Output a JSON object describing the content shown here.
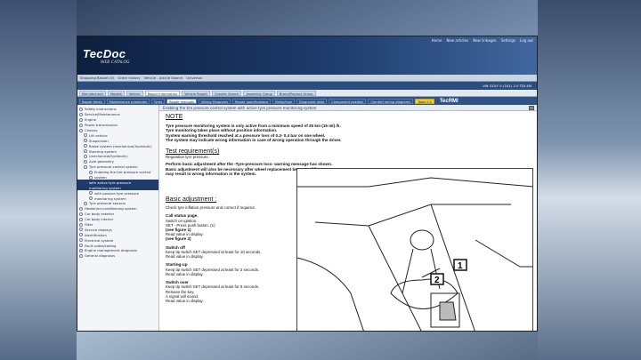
{
  "app": {
    "logo": "TecDoc",
    "logo_sub": "WEB CATALOG",
    "top_links": [
      "Home",
      "New articles",
      "New linkages",
      "Settings",
      "Log out"
    ]
  },
  "menubar": [
    "Shopping Basket (0)",
    "Order history",
    "Vehicle - Article Search",
    "Universal"
  ],
  "vehicle": "VW GOLF V (1K1) 2.0 TDI 4M",
  "tabs1": [
    "Manufacturer",
    "Models",
    "Vehicle",
    "Repair Information",
    "Vehicle Report",
    "Graphic Search",
    "Assembly Group",
    "Brand/Product Group"
  ],
  "tabs1_active": 3,
  "tabs2": [
    "Repair times",
    "Maintenance schedules",
    "Tyres",
    "Repair manuals",
    "Wiring Diagrams",
    "Repair specifications",
    "Relay/fuse",
    "Diagnostic data",
    "Component position",
    "Comfort wiring diagrams",
    "Tools 2.0"
  ],
  "tabs2_active": 3,
  "tecrmi": "TecRMI",
  "breadcrumb": "Enabling the tire pressure control system with active tyre pressure monitoring system",
  "tree": [
    {
      "label": "Safety instructions",
      "level": 0
    },
    {
      "label": "Service/Maintenance",
      "level": 0
    },
    {
      "label": "Engine",
      "level": 0
    },
    {
      "label": "Power transmission",
      "level": 0
    },
    {
      "label": "Chassis",
      "level": 0
    },
    {
      "label": "Lift vehicle",
      "level": 1
    },
    {
      "label": "Suspension",
      "level": 1
    },
    {
      "label": "Brake system (mechanical/hydraulic)",
      "level": 1
    },
    {
      "label": "Steering system",
      "level": 1
    },
    {
      "label": "(mechanical/hydraulic)",
      "level": 1
    },
    {
      "label": "Axle geometry",
      "level": 1
    },
    {
      "label": "Tyre pressure control system",
      "level": 1
    },
    {
      "label": "Enabling the tire pressure control",
      "level": 2
    },
    {
      "label": "system",
      "level": 2
    },
    {
      "label": "with active tyre pressure",
      "level": 2,
      "selected": true
    },
    {
      "label": "monitoring system",
      "level": 2,
      "selected": true
    },
    {
      "label": "with passive tyre pressure",
      "level": 2
    },
    {
      "label": "monitoring system",
      "level": 2
    },
    {
      "label": "Tyre pressure sensors",
      "level": 1
    },
    {
      "label": "Heater/air-conditioning system",
      "level": 0
    },
    {
      "label": "Car body exterior",
      "level": 0
    },
    {
      "label": "Car body interior",
      "level": 0
    },
    {
      "label": "Filter",
      "level": 0
    },
    {
      "label": "Service displays",
      "level": 0
    },
    {
      "label": "Identification",
      "level": 0
    },
    {
      "label": "Electrical system",
      "level": 0
    },
    {
      "label": "Fault codes/coding",
      "level": 0
    },
    {
      "label": "Engine management diagnosis",
      "level": 0
    },
    {
      "label": "General diagnosis",
      "level": 0
    }
  ],
  "note": {
    "heading": "NOTE",
    "lines": [
      "Tyre pressure monitoring system is only active from a minimum speed of 25 km (15 ml) /h.",
      "Tyre monitoring takes place without position information.",
      "System warning threshold reached at a pressure loss of 0.3- 0,4 bar on one wheel.",
      "The system may indicate wrong information in case of wrong operation through the driver."
    ]
  },
  "test": {
    "heading": "Test requirement(s)",
    "sub": "Regulation tyre pressure.",
    "lines": [
      "Perform basic adjustment after the -Tyre-pressure loss- warning message has shown.",
      "Basic adjustment will also be necessary after wheel replacement because different tyre pressures",
      "may result in wrong information in the system."
    ]
  },
  "basic": {
    "heading": "Basic adjustment :",
    "intro": "Check tyre inflation pressure and correct if required.",
    "steps": [
      {
        "title": "Call status page.",
        "lines": [
          "Switch on ignition.",
          "SET - Press push button. (1)",
          "(see figure 1)",
          "Read value in display.",
          "(see figure 2)"
        ]
      },
      {
        "title": "Switch off",
        "lines": [
          "Keep tip switch SET depressed at least for 10 seconds.",
          "Read value in display."
        ]
      },
      {
        "title": "Starting-up",
        "lines": [
          "Keep tip switch SET depressed at least for 2 seconds.",
          "Read value in display."
        ]
      },
      {
        "title": "Switch over",
        "lines": [
          "Keep tip switch SET depressed at least for 8 seconds.",
          "Release the key.",
          "A signal will sound.",
          "Read value in display."
        ]
      }
    ]
  },
  "diagram": {
    "callout_1": "1",
    "callout_2": "2"
  }
}
